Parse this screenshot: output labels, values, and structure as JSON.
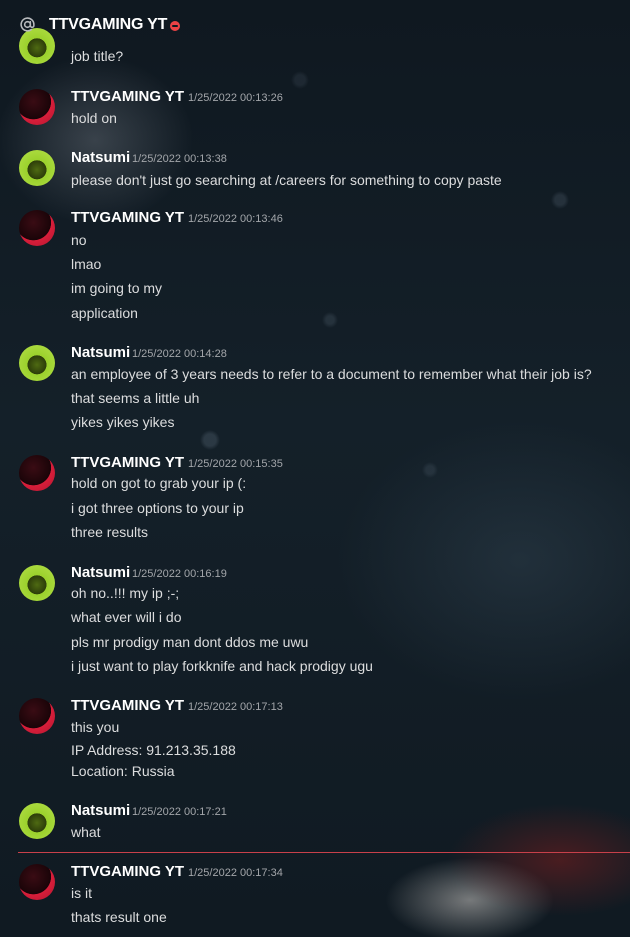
{
  "channel": {
    "name": "TTVGAMING YT",
    "status": "dnd",
    "accent": "#ed4245"
  },
  "colors": {
    "divider": "#c8404a",
    "author": "#ffffff",
    "text": "#dcddde",
    "timestamp": "#a3a6aa"
  },
  "partial": {
    "text": "job title?"
  },
  "messages": [
    {
      "author": "TTVGAMING YT",
      "time": "1/25/2022 00:13:26",
      "lines": [
        "hold on"
      ]
    },
    {
      "author": "Natsumi",
      "time": "1/25/2022 00:13:38",
      "lines": [
        "please don't just go searching at /careers for something to copy paste"
      ]
    },
    {
      "author": "TTVGAMING YT",
      "time": "1/25/2022 00:13:46",
      "lines": [
        "no",
        "lmao",
        "im going to my",
        "application"
      ]
    },
    {
      "author": "Natsumi",
      "time": "1/25/2022 00:14:28",
      "lines": [
        "an employee of 3 years needs to refer to a document to remember what their job is?",
        "that seems a little uh",
        "yikes yikes yikes"
      ]
    },
    {
      "author": "TTVGAMING YT",
      "time": "1/25/2022 00:15:35",
      "lines": [
        "hold on got to grab your ip (:",
        "i got three options to your ip",
        "three results"
      ]
    },
    {
      "author": "Natsumi",
      "time": "1/25/2022 00:16:19",
      "lines": [
        "oh no..!!! my ip ;-;",
        "what ever will i do",
        "pls mr prodigy man dont ddos me uwu",
        "i just want to play forkknife and hack prodigy ugu"
      ]
    },
    {
      "author": "TTVGAMING YT",
      "time": "1/25/2022 00:17:13",
      "lines": [
        "this you",
        "IP Address: 91.213.35.188",
        "Location: Russia"
      ]
    },
    {
      "author": "Natsumi",
      "time": "1/25/2022 00:17:21",
      "lines": [
        "what"
      ]
    },
    {
      "author": "TTVGAMING YT",
      "time": "1/25/2022 00:17:34",
      "lines": [
        "is it",
        "thats result one"
      ]
    }
  ]
}
